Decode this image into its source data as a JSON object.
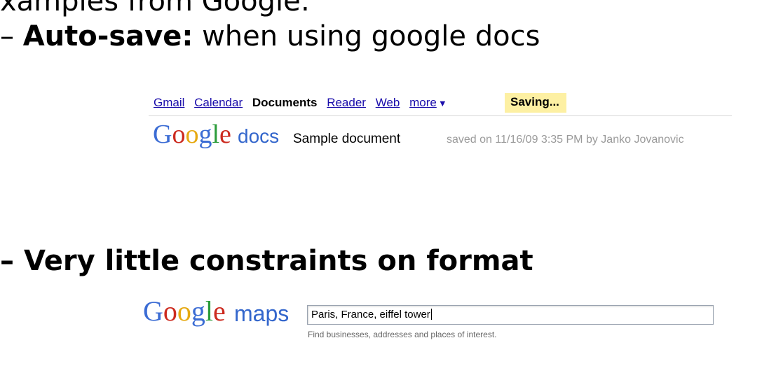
{
  "slide": {
    "top_line": "xamples from Google:",
    "bullet1": {
      "dash": "– ",
      "bold": "Auto-save:",
      "rest": " when using google docs"
    },
    "bullet2": {
      "dash": "– ",
      "bold": "Very little constraints on format"
    }
  },
  "docs": {
    "nav": [
      "Gmail",
      "Calendar",
      "Documents",
      "Reader",
      "Web",
      "more"
    ],
    "more_arrow": "▼",
    "saving": "Saving...",
    "logo_letters": [
      "G",
      "o",
      "o",
      "g",
      "l",
      "e"
    ],
    "product": "docs",
    "title": "Sample document",
    "saved_status": "saved on 11/16/09 3:35 PM by Janko Jovanovic"
  },
  "maps": {
    "logo_letters": [
      "G",
      "o",
      "o",
      "g",
      "l",
      "e"
    ],
    "product": "maps",
    "search_value": "Paris, France, eiffel tower",
    "hint": "Find businesses, addresses and places of interest."
  },
  "colors": {
    "google_blue": "#3b6cd4",
    "google_red": "#cc2a1f",
    "google_yellow": "#e6a911",
    "google_green": "#2b9c3a",
    "saving_highlight": "#fdf0a3",
    "link": "#1a0dab"
  }
}
